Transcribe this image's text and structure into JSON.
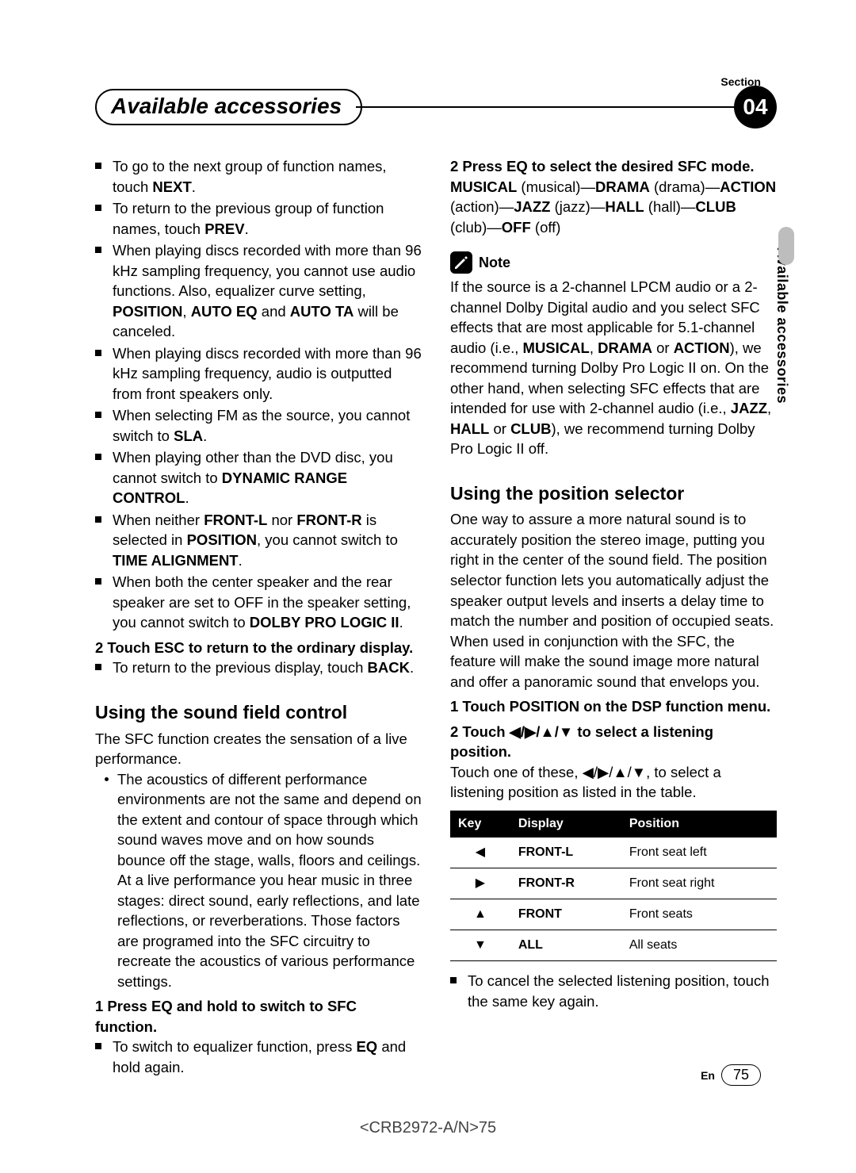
{
  "section_label": "Section",
  "title": "Available accessories",
  "badge": "04",
  "side_tab": "Available accessories",
  "left": {
    "b1a": "To go to the next group of function names, touch ",
    "b1b": "NEXT",
    "b1c": ".",
    "b2a": "To return to the previous group of function names, touch ",
    "b2b": "PREV",
    "b2c": ".",
    "b3a": "When playing discs recorded with more than 96 kHz sampling frequency, you cannot use audio functions. Also, equalizer curve setting, ",
    "b3b": "POSITION",
    "b3c": ", ",
    "b3d": "AUTO EQ",
    "b3e": " and ",
    "b3f": "AUTO TA",
    "b3g": " will be canceled.",
    "b4": "When playing discs recorded with more than 96 kHz sampling frequency, audio is outputted from front speakers only.",
    "b5a": "When selecting FM as the source, you cannot switch to ",
    "b5b": "SLA",
    "b5c": ".",
    "b6a": "When playing other than the DVD disc, you cannot switch to ",
    "b6b": "DYNAMIC RANGE CONTROL",
    "b6c": ".",
    "b7a": "When neither ",
    "b7b": "FRONT-L",
    "b7c": " nor ",
    "b7d": "FRONT-R",
    "b7e": " is selected in ",
    "b7f": "POSITION",
    "b7g": ", you cannot switch to ",
    "b7h": "TIME ALIGNMENT",
    "b7i": ".",
    "b8a": "When both the center speaker and the rear speaker are set to OFF in the speaker setting, you cannot switch to ",
    "b8b": "DOLBY PRO LOGIC II",
    "b8c": ".",
    "step2": "2   Touch ESC to return to the ordinary display.",
    "b9a": "To return to the previous display, touch ",
    "b9b": "BACK",
    "b9c": ".",
    "h_sfc": "Using the sound field control",
    "sfc_intro": "The SFC function creates the sensation of a live performance.",
    "sfc_dot": "The acoustics of different performance environments are not the same and depend on the extent and contour of space through which sound waves move and on how sounds bounce off the stage, walls, floors and ceilings. At a live performance you hear music in three stages: direct sound, early reflections, and late reflections, or reverberations. Those factors are programed into the SFC circuitry to recreate the acoustics of various performance settings.",
    "sfc_step1": "1   Press EQ and hold to switch to SFC function.",
    "sfc_b1a": "To switch to equalizer function, press ",
    "sfc_b1b": "EQ",
    "sfc_b1c": " and hold again."
  },
  "right": {
    "step2": "2   Press EQ to select the desired SFC mode.",
    "modes_a": "MUSICAL",
    "modes_a2": " (musical)—",
    "modes_b": "DRAMA",
    "modes_b2": " (drama)—",
    "modes_c": "ACTION",
    "modes_c2": " (action)—",
    "modes_d": "JAZZ",
    "modes_d2": " (jazz)—",
    "modes_e": "HALL",
    "modes_e2": " (hall)—",
    "modes_f": "CLUB",
    "modes_f2": " (club)—",
    "modes_g": "OFF",
    "modes_g2": " (off)",
    "note_label": "Note",
    "note_a": "If the source is a 2-channel LPCM audio or a 2-channel Dolby Digital audio and you select SFC effects that are most applicable for 5.1-channel audio (i.e., ",
    "note_b": "MUSICAL",
    "note_c": ", ",
    "note_d": "DRAMA",
    "note_e": " or ",
    "note_f": "ACTION",
    "note_g": "), we recommend turning Dolby Pro Logic II on. On the other hand, when selecting SFC effects that are intended for use with 2-channel audio (i.e., ",
    "note_h": "JAZZ",
    "note_i": ", ",
    "note_j": "HALL",
    "note_k": " or ",
    "note_l": "CLUB",
    "note_m": "), we recommend turning Dolby Pro Logic II off.",
    "h_pos": "Using the position selector",
    "pos_intro": "One way to assure a more natural sound is to accurately position the stereo image, putting you right in the center of the sound field. The position selector function lets you automatically adjust the speaker output levels and inserts a delay time to match the number and position of occupied seats. When used in conjunction with the SFC, the feature will make the sound image more natural and offer a panoramic sound that envelops you.",
    "pos_step1": "1   Touch POSITION on the DSP function menu.",
    "pos_step2a": "2   Touch ",
    "pos_step2b": " to select a listening position.",
    "pos_instr_a": "Touch one of these, ",
    "pos_instr_b": ", to select a listening position as listed in the table.",
    "th_key": "Key",
    "th_display": "Display",
    "th_position": "Position",
    "r1_key": "◀",
    "r1_disp": "FRONT-L",
    "r1_pos": "Front seat left",
    "r2_key": "▶",
    "r2_disp": "FRONT-R",
    "r2_pos": "Front seat right",
    "r3_key": "▲",
    "r3_disp": "FRONT",
    "r3_pos": "Front seats",
    "r4_key": "▼",
    "r4_disp": "ALL",
    "r4_pos": "All seats",
    "cancel": "To cancel the selected listening position, touch the same key again."
  },
  "footer": {
    "en": "En",
    "page": "75",
    "code": "<CRB2972-A/N>75"
  },
  "arrows": "◀/▶/▲/▼"
}
